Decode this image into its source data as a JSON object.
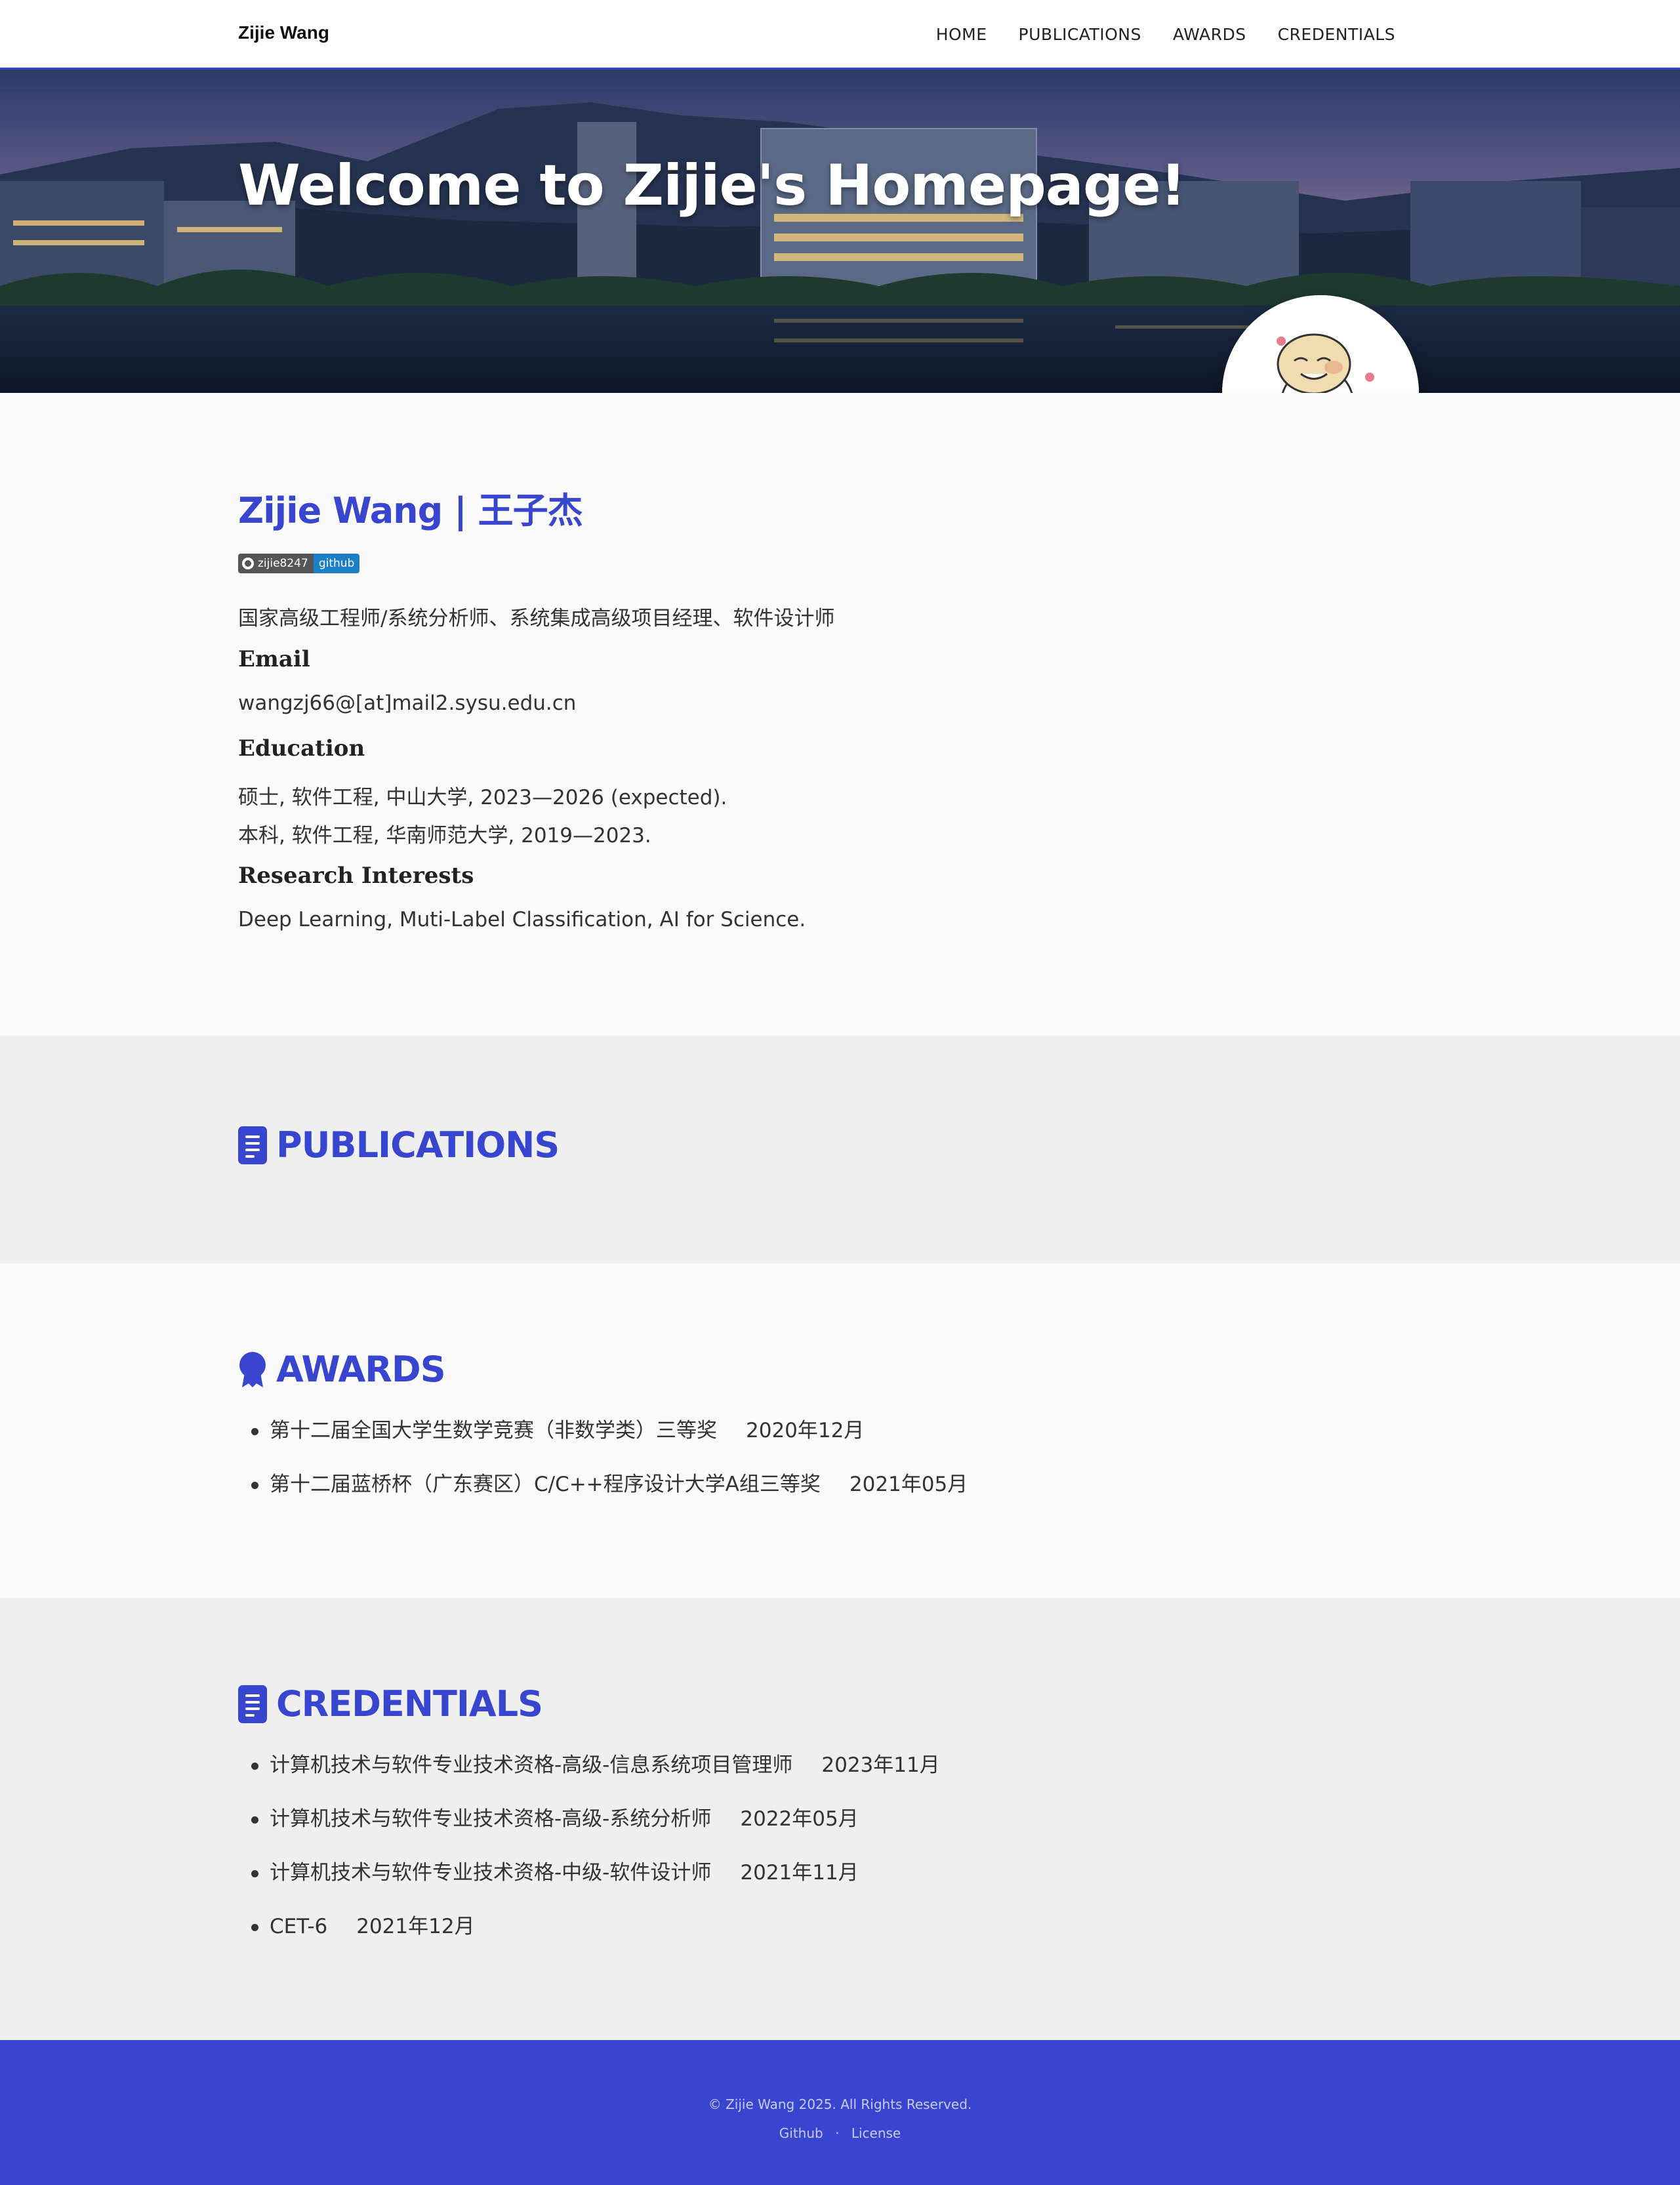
{
  "navbar": {
    "brand": "Zijie Wang",
    "links": [
      "HOME",
      "PUBLICATIONS",
      "AWARDS",
      "CREDENTIALS"
    ]
  },
  "hero": {
    "title": "Welcome to Zijie's Homepage!"
  },
  "about": {
    "name": "Zijie Wang  |  王子杰",
    "badge": {
      "user": "zijie8247",
      "label": "github"
    },
    "title": "国家高级工程师/系统分析师、系统集成高级项目经理、软件设计师",
    "email_heading": "Email",
    "email": "wangzj66@[at]mail2.sysu.edu.cn",
    "education_heading": "Education",
    "education": [
      "硕士, 软件工程, 中山大学, 2023—2026 (expected).",
      "本科, 软件工程, 华南师范大学, 2019—2023."
    ],
    "research_heading": "Research Interests",
    "research": "Deep Learning, Muti-Label Classification, AI for Science."
  },
  "publications": {
    "title": "PUBLICATIONS"
  },
  "awards": {
    "title": "AWARDS",
    "items": [
      {
        "name": "第十二届全国大学生数学竞赛（非数学类）三等奖",
        "date": "2020年12月"
      },
      {
        "name": "第十二届蓝桥杯（广东赛区）C/C++程序设计大学A组三等奖",
        "date": "2021年05月"
      }
    ]
  },
  "credentials": {
    "title": "CREDENTIALS",
    "items": [
      {
        "name": "计算机技术与软件专业技术资格-高级-信息系统项目管理师",
        "date": "2023年11月"
      },
      {
        "name": "计算机技术与软件专业技术资格-高级-系统分析师",
        "date": "2022年05月"
      },
      {
        "name": "计算机技术与软件专业技术资格-中级-软件设计师",
        "date": "2021年11月"
      },
      {
        "name": "CET-6",
        "date": "2021年12月"
      }
    ]
  },
  "footer": {
    "copyright": "© Zijie Wang 2025. All Rights Reserved.",
    "links": [
      "Github",
      "License"
    ],
    "separator": "·"
  },
  "colors": {
    "accent": "#3845cf",
    "footer_bg": "#3845cf",
    "badge_blue": "#1a7fc4"
  }
}
